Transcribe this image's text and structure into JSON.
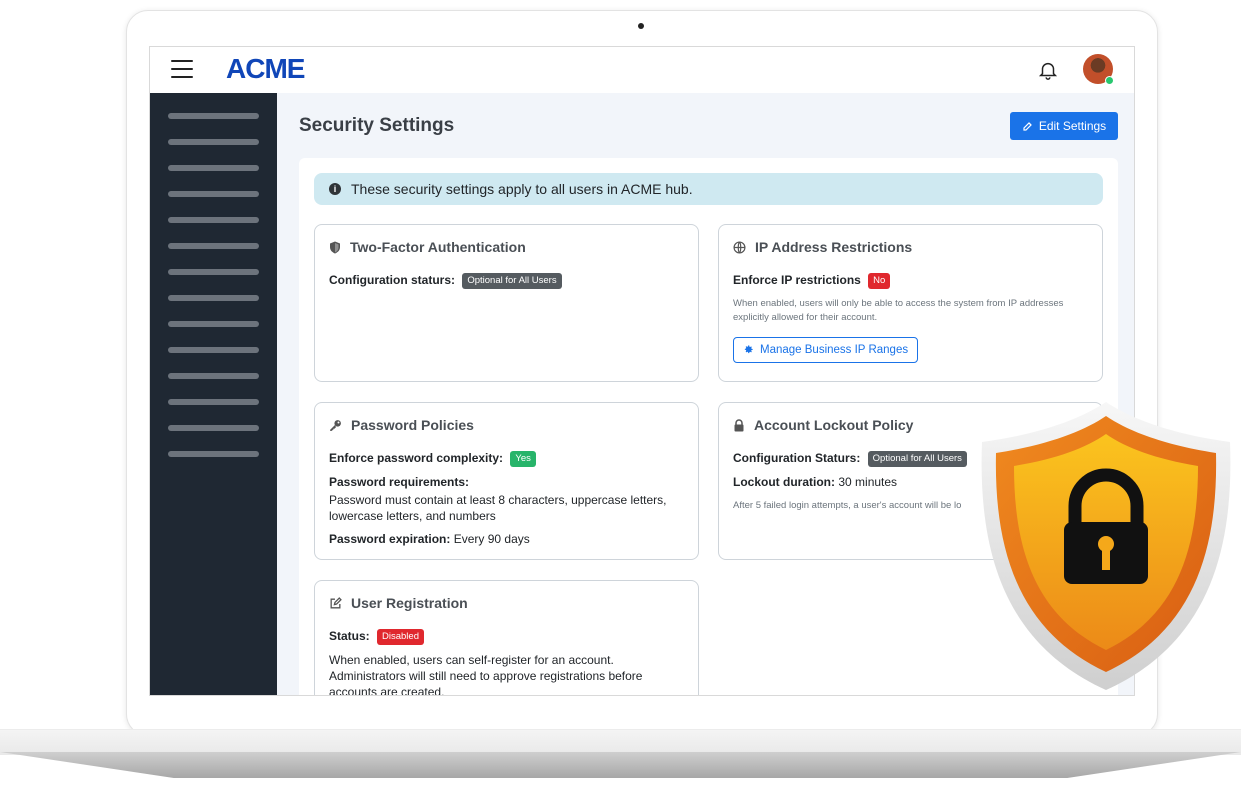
{
  "app": {
    "logo_text": "ACME",
    "brand_color": "#1046b8",
    "accent_color": "#f2a20f"
  },
  "header": {
    "menu_icon": "hamburger-icon",
    "notification_icon": "bell-icon",
    "avatar_status_color": "#28c76f"
  },
  "page": {
    "title": "Security Settings",
    "edit_button_label": "Edit Settings",
    "edit_button_color": "#1a73e8"
  },
  "alert": {
    "text": "These security settings apply to all users in ACME hub."
  },
  "cards": {
    "two_factor": {
      "title": "Two-Factor Authentication",
      "icon": "shield-icon",
      "config_label": "Configuration staturs:",
      "config_value": "Optional for All Users"
    },
    "ip_restrictions": {
      "title": "IP Address Restrictions",
      "icon": "globe-icon",
      "enforce_label": "Enforce IP restrictions",
      "enforce_value": "No",
      "description": "When enabled, users will only be able to access the system from IP addresses explicitly allowed for their account.",
      "manage_button_label": "Manage Business IP Ranges"
    },
    "password": {
      "title": "Password Policies",
      "icon": "key-icon",
      "complexity_label": "Enforce password complexity:",
      "complexity_value": "Yes",
      "requirements_label": "Password requirements:",
      "requirements_text": "Password must contain at least 8 characters, uppercase letters, lowercase letters, and numbers",
      "expiration_label": "Password expiration:",
      "expiration_value": "Every 90 days"
    },
    "lockout": {
      "title": "Account Lockout Policy",
      "icon": "lock-icon",
      "config_label": "Configuration Staturs:",
      "config_value": "Optional for All Users",
      "duration_label": "Lockout duration:",
      "duration_value": "30 minutes",
      "description": "After 5 failed login attempts, a user's account will be lo"
    },
    "registration": {
      "title": "User Registration",
      "icon": "edit-icon",
      "status_label": "Status:",
      "status_value": "Disabled",
      "description": "When enabled, users can self-register for an account. Administrators will still need to approve registrations before accounts are created."
    }
  },
  "overlay": {
    "icon": "security-shield-lock-icon",
    "outer_color": "#e8781a",
    "inner_color": "#f7b21a"
  }
}
